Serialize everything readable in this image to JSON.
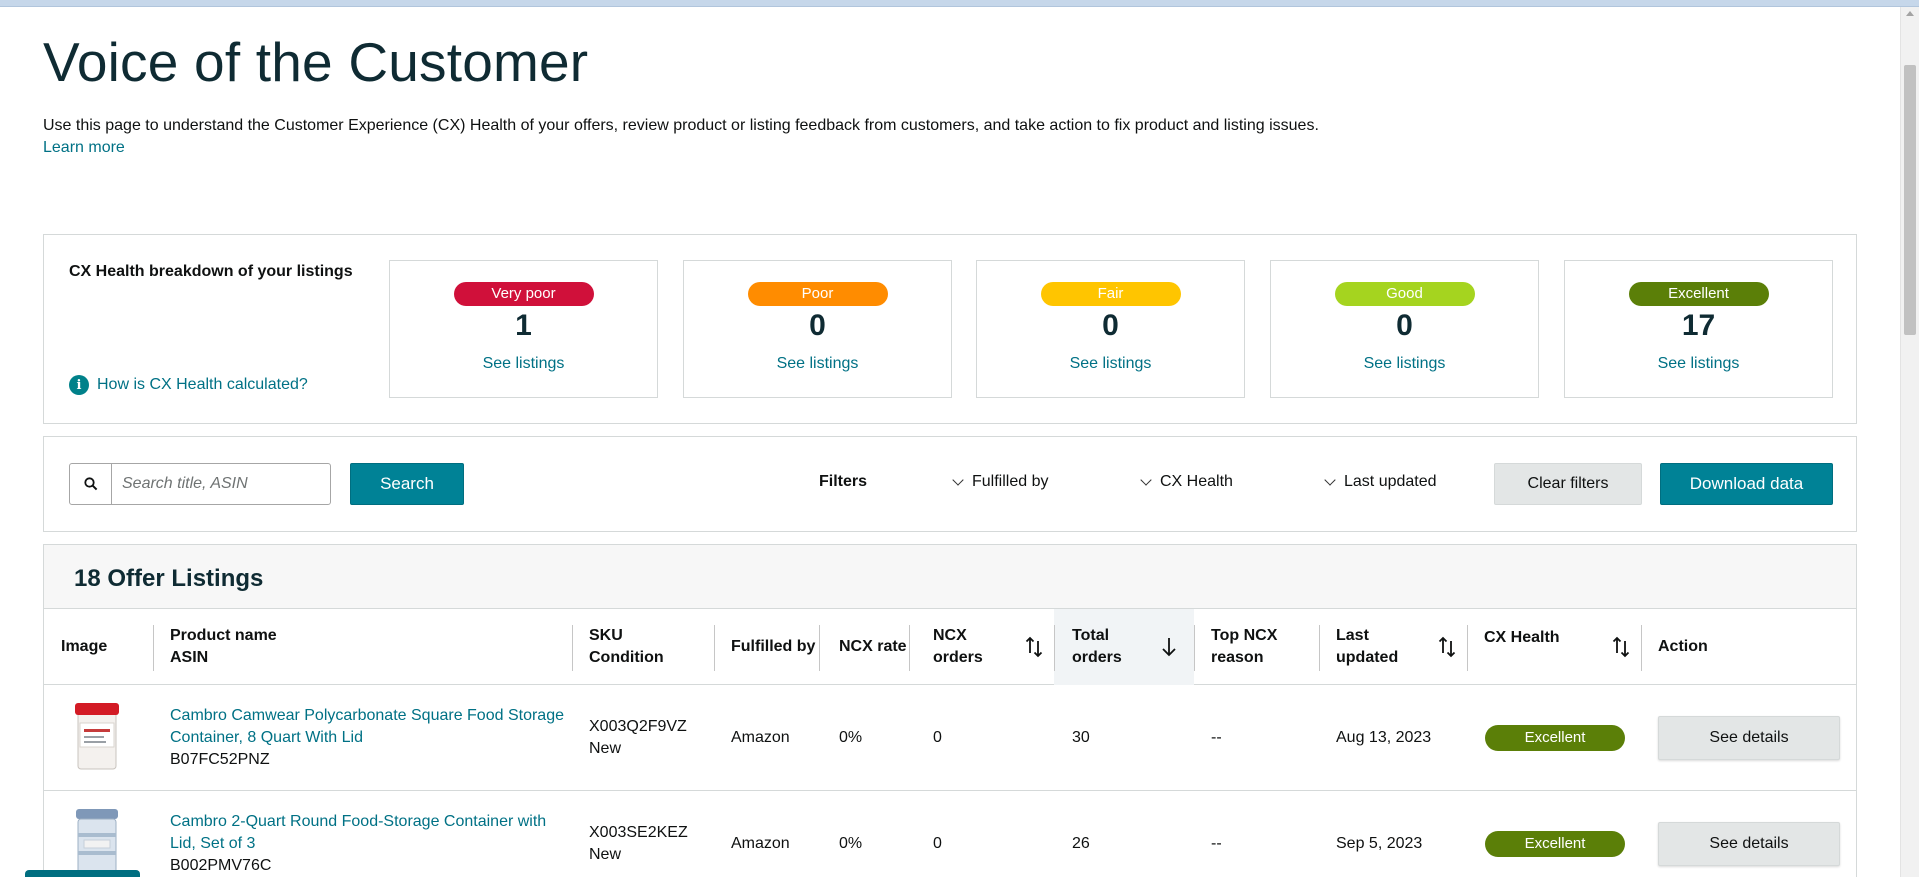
{
  "page": {
    "title": "Voice of the Customer",
    "description": "Use this page to understand the Customer Experience (CX) Health of your offers, review product or listing feedback from customers, and take action to fix product and listing issues.",
    "learn_more": "Learn more"
  },
  "health": {
    "heading": "CX Health breakdown of your listings",
    "help_link": "How is CX Health calculated?",
    "help_icon": "info-icon",
    "cards": [
      {
        "label": "Very poor",
        "count": "1",
        "link": "See listings",
        "color": "#d0103a"
      },
      {
        "label": "Poor",
        "count": "0",
        "link": "See listings",
        "color": "#ff8c00"
      },
      {
        "label": "Fair",
        "count": "0",
        "link": "See listings",
        "color": "#ffc500"
      },
      {
        "label": "Good",
        "count": "0",
        "link": "See listings",
        "color": "#a5d41f"
      },
      {
        "label": "Excellent",
        "count": "17",
        "link": "See listings",
        "color": "#5b7f08"
      }
    ]
  },
  "filters": {
    "search_placeholder": "Search title, ASIN",
    "search_button": "Search",
    "label": "Filters",
    "dropdowns": [
      "Fulfilled by",
      "CX Health",
      "Last updated"
    ],
    "clear": "Clear filters",
    "download": "Download data"
  },
  "table": {
    "title": "18 Offer Listings",
    "columns": {
      "image": "Image",
      "product_1": "Product name",
      "product_2": "ASIN",
      "sku_1": "SKU",
      "sku_2": "Condition",
      "fulfilled": "Fulfilled by",
      "ncx_rate": "NCX rate",
      "ncx_orders_1": "NCX",
      "ncx_orders_2": "orders",
      "total_1": "Total",
      "total_2": "orders",
      "reason_1": "Top NCX",
      "reason_2": "reason",
      "updated_1": "Last",
      "updated_2": "updated",
      "cx_health": "CX Health",
      "action": "Action"
    },
    "rows": [
      {
        "product": "Cambro Camwear Polycarbonate Square Food Storage Container, 8 Quart With Lid",
        "asin": "B07FC52PNZ",
        "sku": "X003Q2F9VZ",
        "condition": "New",
        "fulfilled_by": "Amazon",
        "ncx_rate": "0%",
        "ncx_orders": "0",
        "total_orders": "30",
        "top_reason": "--",
        "last_updated": "Aug 13, 2023",
        "cx_health": "Excellent",
        "action": "See details"
      },
      {
        "product": "Cambro 2-Quart Round Food-Storage Container with Lid, Set of 3",
        "asin": "B002PMV76C",
        "sku": "X003SE2KEZ",
        "condition": "New",
        "fulfilled_by": "Amazon",
        "ncx_rate": "0%",
        "ncx_orders": "0",
        "total_orders": "26",
        "top_reason": "--",
        "last_updated": "Sep 5, 2023",
        "cx_health": "Excellent",
        "action": "See details"
      }
    ]
  }
}
